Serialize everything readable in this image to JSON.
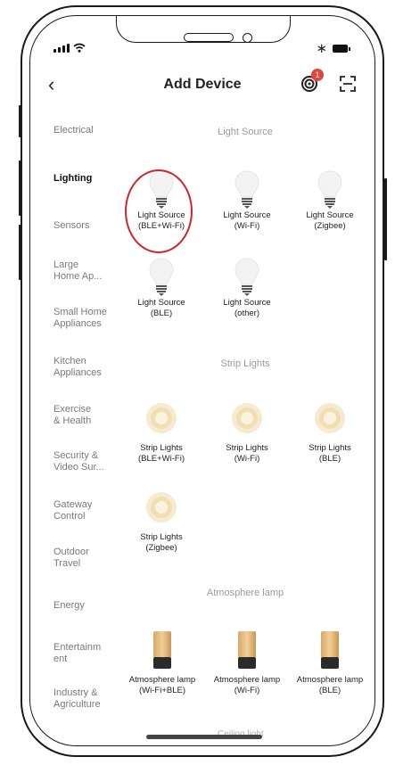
{
  "header": {
    "title": "Add Device",
    "badge_count": "1"
  },
  "sidebar": {
    "items": [
      {
        "label": "Electrical",
        "active": false
      },
      {
        "label": "Lighting",
        "active": true
      },
      {
        "label": "Sensors",
        "active": false
      },
      {
        "label": "Large Home Ap...",
        "active": false
      },
      {
        "label": "Small Home Appliances",
        "active": false
      },
      {
        "label": "Kitchen Appliances",
        "active": false
      },
      {
        "label": "Exercise & Health",
        "active": false
      },
      {
        "label": "Security & Video Sur...",
        "active": false
      },
      {
        "label": "Gateway Control",
        "active": false
      },
      {
        "label": "Outdoor Travel",
        "active": false
      },
      {
        "label": "Energy",
        "active": false
      },
      {
        "label": "Entertainm ent",
        "active": false
      },
      {
        "label": "Industry & Agriculture",
        "active": false
      }
    ]
  },
  "sections": [
    {
      "title": "Light Source",
      "items": [
        {
          "name": "Light Source",
          "sub": "(BLE+Wi-Fi)",
          "icon": "bulb-icon",
          "highlighted": true
        },
        {
          "name": "Light Source",
          "sub": "(Wi-Fi)",
          "icon": "bulb-icon"
        },
        {
          "name": "Light Source",
          "sub": "(Zigbee)",
          "icon": "bulb-icon"
        },
        {
          "name": "Light Source",
          "sub": "(BLE)",
          "icon": "bulb-icon"
        },
        {
          "name": "Light Source",
          "sub": "(other)",
          "icon": "bulb-icon"
        }
      ]
    },
    {
      "title": "Strip Lights",
      "items": [
        {
          "name": "Strip Lights",
          "sub": "(BLE+Wi-Fi)",
          "icon": "strip-light-icon"
        },
        {
          "name": "Strip Lights",
          "sub": "(Wi-Fi)",
          "icon": "strip-light-icon"
        },
        {
          "name": "Strip Lights",
          "sub": "(BLE)",
          "icon": "strip-light-icon"
        },
        {
          "name": "Strip Lights",
          "sub": "(Zigbee)",
          "icon": "strip-light-icon"
        }
      ]
    },
    {
      "title": "Atmosphere lamp",
      "items": [
        {
          "name": "Atmosphere lamp",
          "sub": "(Wi-Fi+BLE)",
          "icon": "atmosphere-lamp-icon"
        },
        {
          "name": "Atmosphere lamp",
          "sub": "(Wi-Fi)",
          "icon": "atmosphere-lamp-icon"
        },
        {
          "name": "Atmosphere lamp",
          "sub": "(BLE)",
          "icon": "atmosphere-lamp-icon"
        }
      ]
    },
    {
      "title": "Ceiling light",
      "items": []
    }
  ],
  "colors": {
    "highlight": "#d0242b",
    "badge": "#e2453c",
    "strip_glow": "#f4e3b0",
    "lamp_top": "#e0b277"
  }
}
